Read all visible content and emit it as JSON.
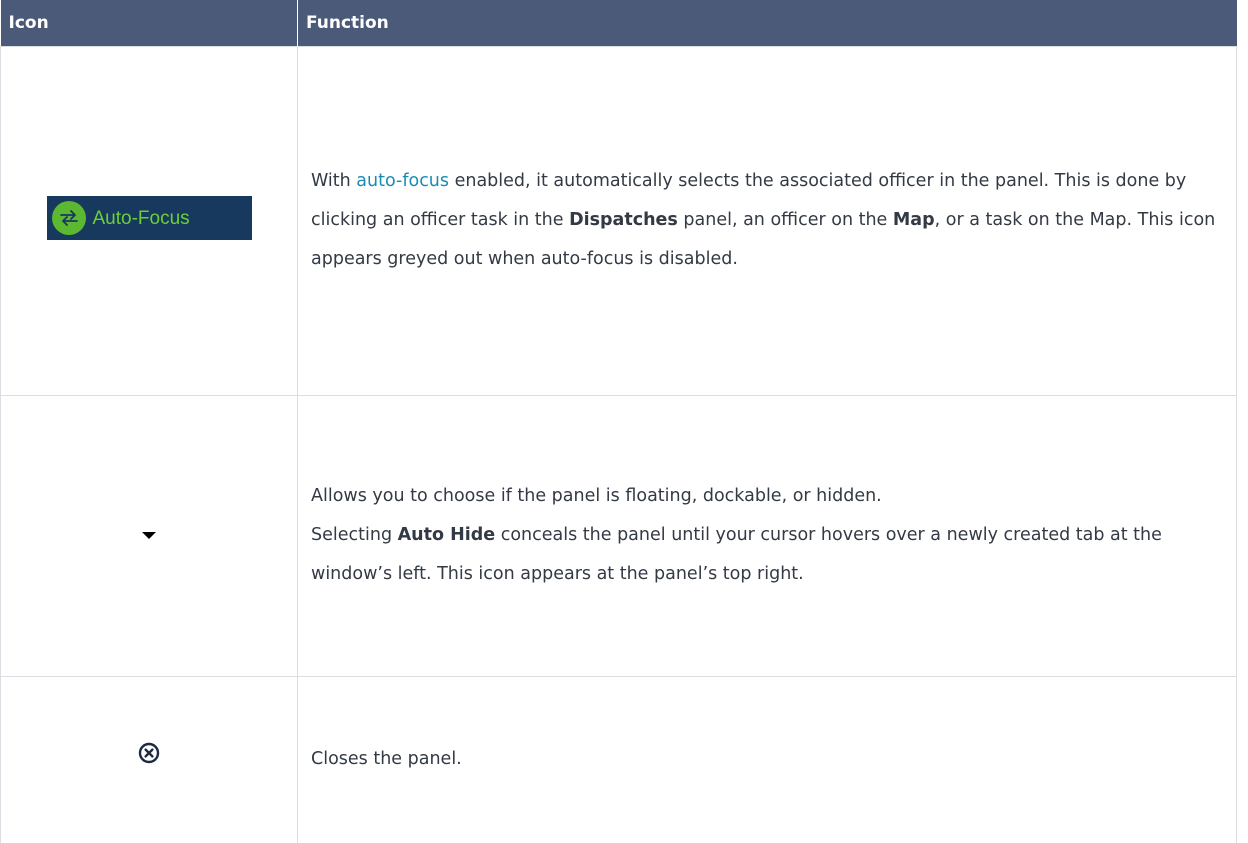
{
  "table": {
    "headers": [
      "Icon",
      "Function"
    ],
    "rows": [
      {
        "icon_name": "auto-focus-icon",
        "icon_label": "Auto-Focus",
        "function": {
          "t1": "With ",
          "link": "auto-focus",
          "t2": " enabled, it automatically selects the associated officer in the panel. This is done by clicking an officer task in the ",
          "b1": "Dispatches",
          "t3": " panel, an officer on the ",
          "b2": "Map",
          "t4": ", or a task on the Map. This icon appears greyed out when auto-focus is disabled."
        }
      },
      {
        "icon_name": "chevron-down-icon",
        "function": {
          "line1": "Allows you to choose if the panel is floating, dockable, or hidden.",
          "t1": "Selecting ",
          "b1": "Auto Hide",
          "t2": " conceals the panel until your cursor hovers over a newly created tab at the window’s left. This icon appears at the panel’s top right."
        }
      },
      {
        "icon_name": "close-icon",
        "function": {
          "text": "Closes the panel."
        }
      }
    ]
  },
  "colors": {
    "header_bg": "#4a5a78",
    "link": "#1a8bb5",
    "badge_bg": "#17395e",
    "badge_green": "#5bb830"
  }
}
